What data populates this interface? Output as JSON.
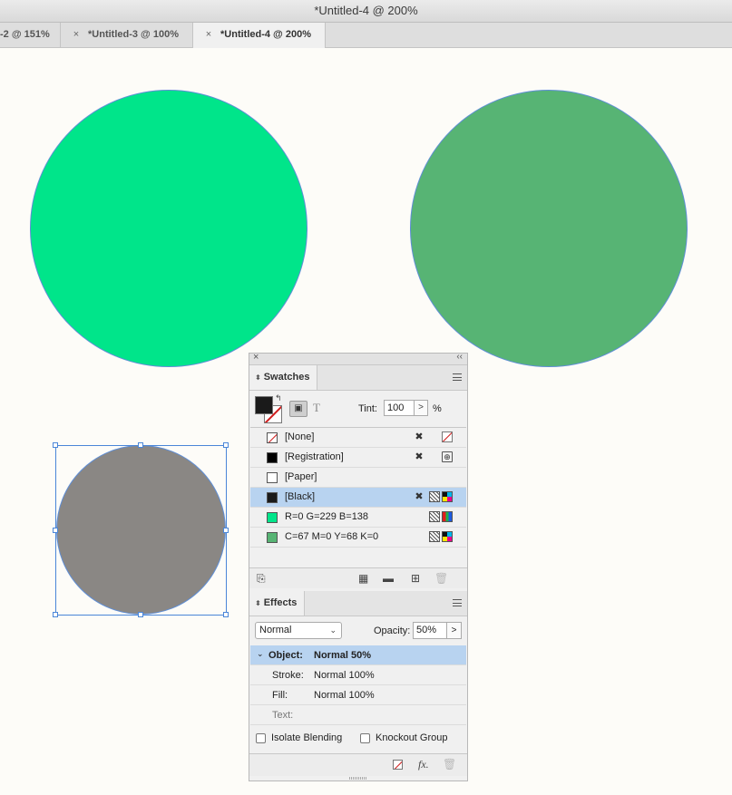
{
  "window": {
    "title": "*Untitled-4 @ 200%"
  },
  "tabs": [
    {
      "label": "-2 @ 151%",
      "close": ""
    },
    {
      "label": "*Untitled-3 @ 100%",
      "close": "×"
    },
    {
      "label": "*Untitled-4 @ 200%",
      "close": "×"
    }
  ],
  "canvas": {
    "shapes": [
      {
        "name": "bright-green-circle",
        "fill": "#00e58a"
      },
      {
        "name": "muted-green-circle",
        "fill": "#57b474"
      },
      {
        "name": "gray-circle-selected",
        "fill": "#8a8784"
      }
    ]
  },
  "swatches": {
    "tab_label": "Swatches",
    "tint_label": "Tint:",
    "tint_value": "100",
    "tint_unit": "%",
    "step_glyph": ">",
    "text_glyph": "T",
    "items": [
      {
        "name": "[None]",
        "chip": "none",
        "icons": [
          "no-edit-icon",
          "none-type-icon"
        ]
      },
      {
        "name": "[Registration]",
        "chip": "#000000",
        "icons": [
          "no-edit-icon",
          "registration-icon"
        ]
      },
      {
        "name": "[Paper]",
        "chip": "#ffffff",
        "icons": []
      },
      {
        "name": "[Black]",
        "chip": "#1a1a1a",
        "icons": [
          "no-edit-icon",
          "process-icon",
          "cmyk-icon"
        ],
        "selected": true
      },
      {
        "name": "R=0 G=229 B=138",
        "chip": "#00e58a",
        "icons": [
          "process-icon",
          "rgb-icon"
        ]
      },
      {
        "name": "C=67 M=0 Y=68 K=0",
        "chip": "#57b474",
        "icons": [
          "process-icon",
          "cmyk-icon"
        ]
      }
    ]
  },
  "effects": {
    "tab_label": "Effects",
    "blend_mode": "Normal",
    "opacity_label": "Opacity:",
    "opacity_value": "50%",
    "step_glyph": ">",
    "rows": [
      {
        "label": "Object:",
        "value": "Normal 50%",
        "selected": true
      },
      {
        "label": "Stroke:",
        "value": "Normal 100%"
      },
      {
        "label": "Fill:",
        "value": "Normal 100%"
      },
      {
        "label": "Text:",
        "value": ""
      }
    ],
    "isolate_label": "Isolate Blending",
    "knockout_label": "Knockout Group",
    "fx_label": "fx."
  },
  "colors": {
    "selection": "#4a86d8",
    "row_highlight": "#b8d3f0"
  }
}
